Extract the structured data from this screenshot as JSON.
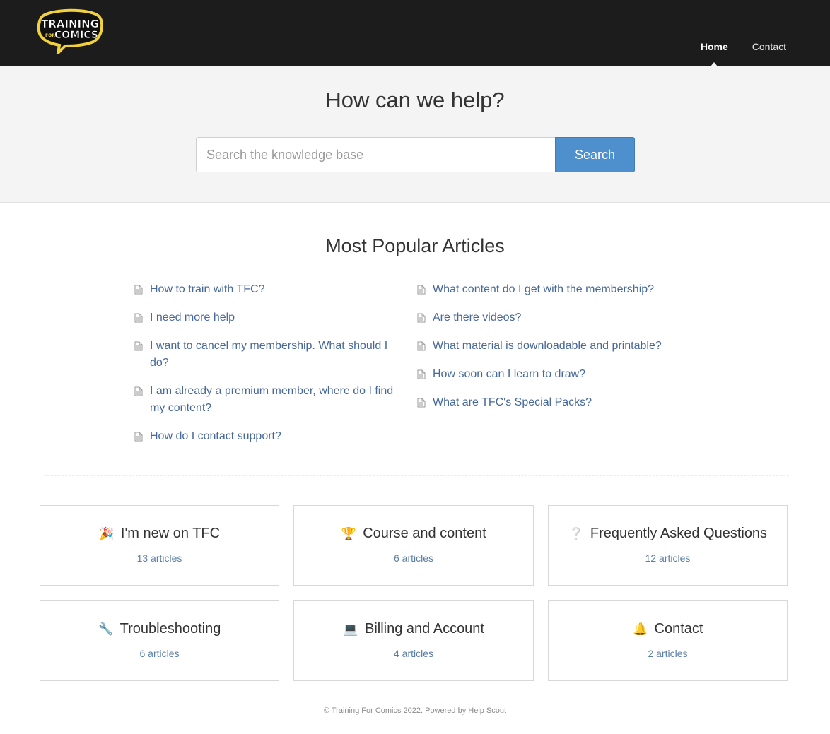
{
  "header": {
    "logo_text_top": "TRAINING",
    "logo_text_for": "FOR",
    "logo_text_bottom": "COMICS",
    "nav": [
      {
        "label": "Home",
        "active": true
      },
      {
        "label": "Contact",
        "active": false
      }
    ]
  },
  "hero": {
    "title": "How can we help?",
    "search_placeholder": "Search the knowledge base",
    "search_value": "",
    "search_button": "Search"
  },
  "popular": {
    "title": "Most Popular Articles",
    "left": [
      "How to train with TFC?",
      "I need more help",
      "I want to cancel my membership. What should I do?",
      "I am already a premium member, where do I find my content?",
      "How do I contact support?"
    ],
    "right": [
      "What content do I get with the membership?",
      "Are there videos?",
      "What material is downloadable and printable?",
      "How soon can I learn to draw?",
      "What are TFC's Special Packs?"
    ]
  },
  "categories": [
    {
      "icon": "🎉",
      "icon_name": "party-popper-icon",
      "title": "I'm new on TFC",
      "count": "13 articles"
    },
    {
      "icon": "🏆",
      "icon_name": "trophy-icon",
      "title": "Course and content",
      "count": "6 articles"
    },
    {
      "icon": "❔",
      "icon_name": "question-mark-icon",
      "title": "Frequently Asked Questions",
      "count": "12 articles"
    },
    {
      "icon": "🔧",
      "icon_name": "wrench-icon",
      "title": "Troubleshooting",
      "count": "6 articles"
    },
    {
      "icon": "💻",
      "icon_name": "laptop-icon",
      "title": "Billing and Account",
      "count": "4 articles"
    },
    {
      "icon": "🔔",
      "icon_name": "bell-icon",
      "title": "Contact",
      "count": "2 articles"
    }
  ],
  "footer": {
    "text": "© Training For Comics 2022. Powered by Help Scout"
  },
  "colors": {
    "header_bg": "#1c1c1c",
    "hero_bg": "#f4f4f4",
    "accent": "#4d90cd",
    "link": "#46689a"
  }
}
